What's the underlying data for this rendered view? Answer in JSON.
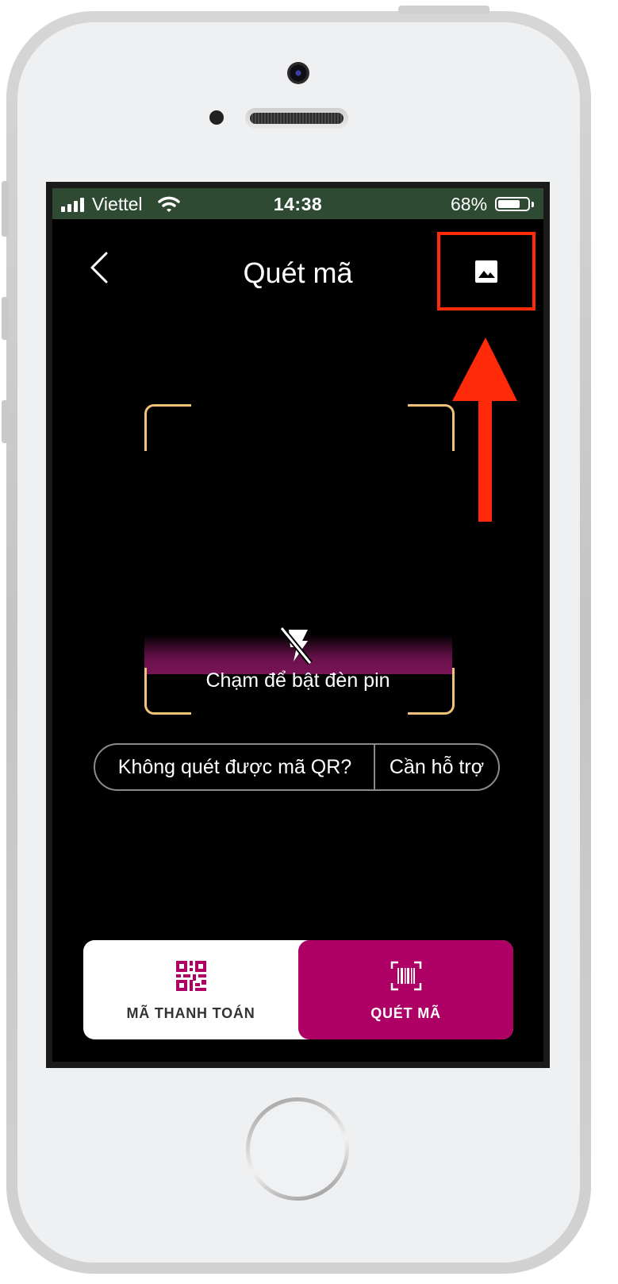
{
  "status_bar": {
    "carrier": "Viettel",
    "time": "14:38",
    "battery_percent": "68%",
    "battery_level": 0.68,
    "icons": [
      "signal-icon",
      "wifi-icon",
      "battery-icon"
    ]
  },
  "nav": {
    "title": "Quét mã",
    "back_icon": "chevron-left-icon",
    "gallery_icon": "image-gallery-icon"
  },
  "scanner": {
    "torch_hint": "Chạm để bật đèn pin",
    "flash_icon": "flash-off-icon",
    "frame_color": "#f2c27b"
  },
  "help": {
    "question": "Không quét được mã QR?",
    "support": "Cần hỗ trợ"
  },
  "tabs": [
    {
      "label": "MÃ THANH TOÁN",
      "icon": "qr-code-icon",
      "active": false
    },
    {
      "label": "QUÉT MÃ",
      "icon": "barcode-scan-icon",
      "active": true
    }
  ],
  "colors": {
    "brand": "#ae0064",
    "status_bar_bg": "#2f4a33",
    "annotation": "#ff2a0a"
  }
}
